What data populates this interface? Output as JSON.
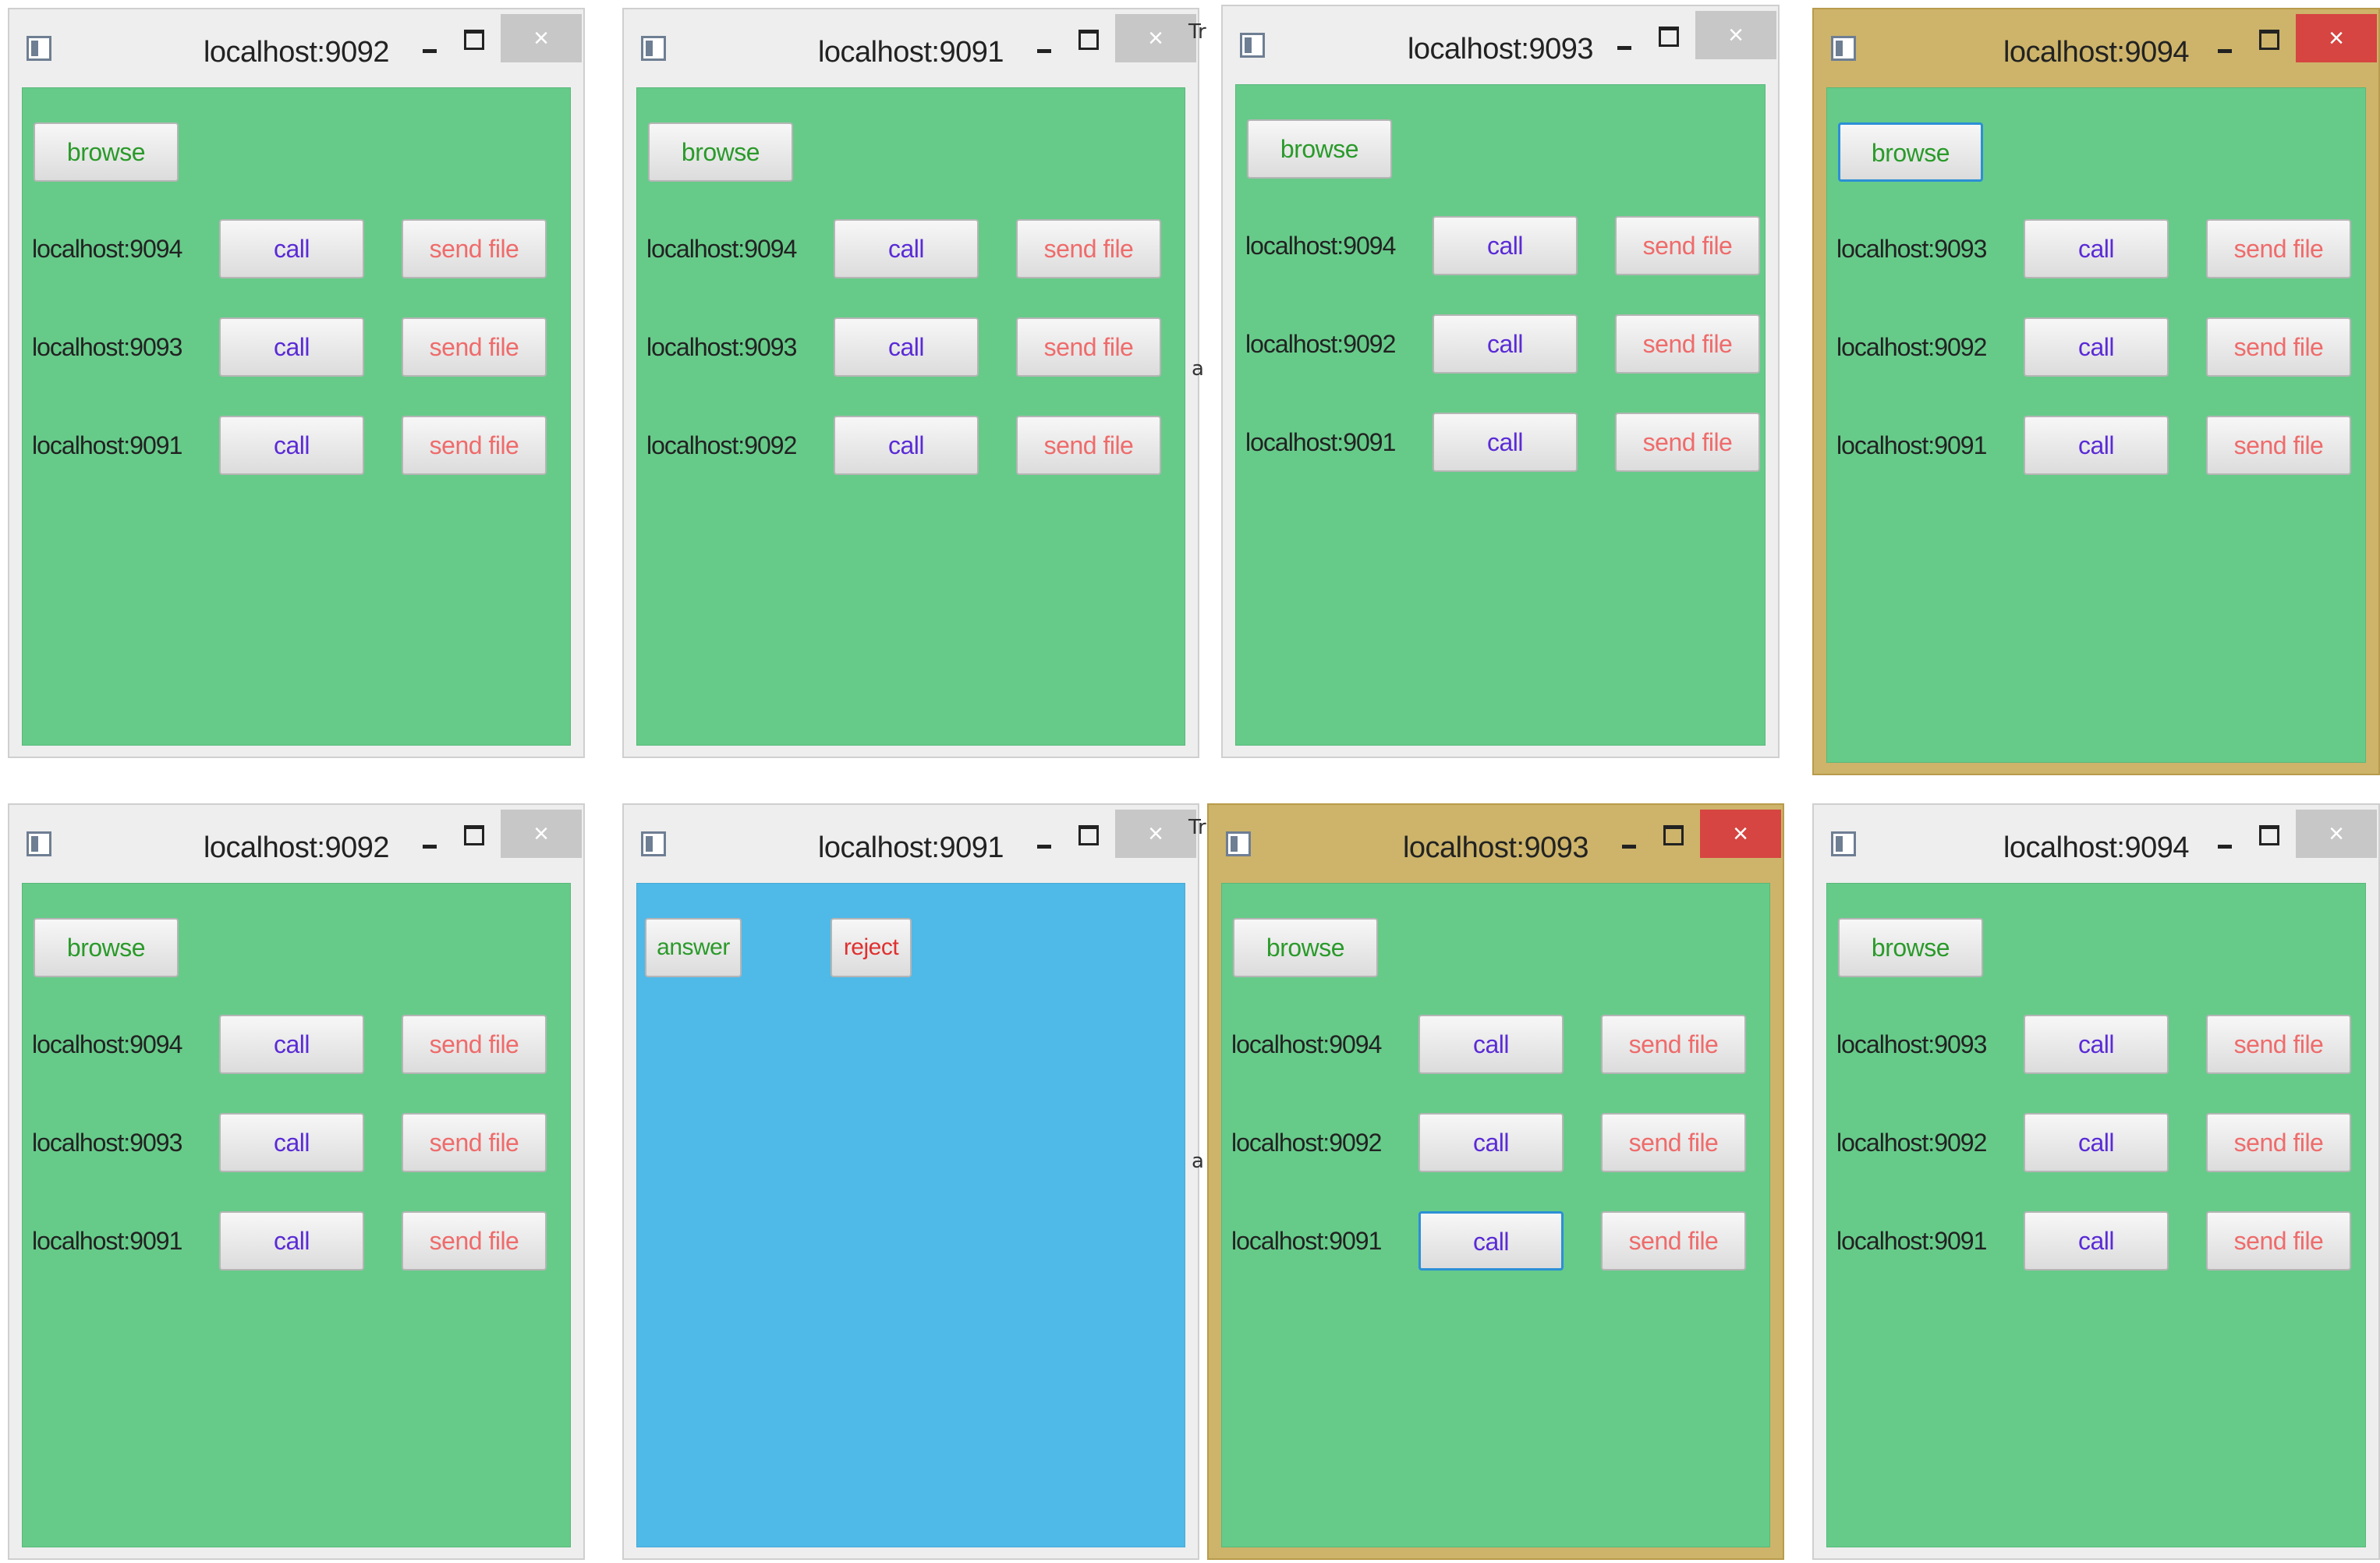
{
  "windows": [
    {
      "title": "localhost:9092",
      "active": false,
      "mode": "peers",
      "browse_label": "browse",
      "peers": [
        {
          "host": "localhost:9094",
          "call": "call",
          "send": "send file"
        },
        {
          "host": "localhost:9093",
          "call": "call",
          "send": "send file"
        },
        {
          "host": "localhost:9091",
          "call": "call",
          "send": "send file"
        }
      ]
    },
    {
      "title": "localhost:9091",
      "active": false,
      "mode": "peers",
      "browse_label": "browse",
      "peers": [
        {
          "host": "localhost:9094",
          "call": "call",
          "send": "send file"
        },
        {
          "host": "localhost:9093",
          "call": "call",
          "send": "send file"
        },
        {
          "host": "localhost:9092",
          "call": "call",
          "send": "send file"
        }
      ]
    },
    {
      "title": "localhost:9093",
      "active": false,
      "mode": "peers",
      "browse_label": "browse",
      "peers": [
        {
          "host": "localhost:9094",
          "call": "call",
          "send": "send file"
        },
        {
          "host": "localhost:9092",
          "call": "call",
          "send": "send file"
        },
        {
          "host": "localhost:9091",
          "call": "call",
          "send": "send file"
        }
      ]
    },
    {
      "title": "localhost:9094",
      "active": true,
      "mode": "peers",
      "browse_label": "browse",
      "browse_focused": true,
      "peers": [
        {
          "host": "localhost:9093",
          "call": "call",
          "send": "send file"
        },
        {
          "host": "localhost:9092",
          "call": "call",
          "send": "send file"
        },
        {
          "host": "localhost:9091",
          "call": "call",
          "send": "send file"
        }
      ]
    },
    {
      "title": "localhost:9092",
      "active": false,
      "mode": "peers",
      "browse_label": "browse",
      "peers": [
        {
          "host": "localhost:9094",
          "call": "call",
          "send": "send file"
        },
        {
          "host": "localhost:9093",
          "call": "call",
          "send": "send file"
        },
        {
          "host": "localhost:9091",
          "call": "call",
          "send": "send file"
        }
      ]
    },
    {
      "title": "localhost:9091",
      "active": false,
      "mode": "incoming",
      "answer_label": "answer",
      "reject_label": "reject"
    },
    {
      "title": "localhost:9093",
      "active": true,
      "mode": "peers",
      "browse_label": "browse",
      "focused_call_row": 2,
      "peers": [
        {
          "host": "localhost:9094",
          "call": "call",
          "send": "send file"
        },
        {
          "host": "localhost:9092",
          "call": "call",
          "send": "send file"
        },
        {
          "host": "localhost:9091",
          "call": "call",
          "send": "send file"
        }
      ]
    },
    {
      "title": "localhost:9094",
      "active": false,
      "mode": "peers",
      "browse_label": "browse",
      "peers": [
        {
          "host": "localhost:9093",
          "call": "call",
          "send": "send file"
        },
        {
          "host": "localhost:9092",
          "call": "call",
          "send": "send file"
        },
        {
          "host": "localhost:9091",
          "call": "call",
          "send": "send file"
        }
      ]
    }
  ],
  "controls": {
    "minimize": "minimize",
    "maximize": "maximize",
    "close": "×"
  },
  "background_fragments": [
    "Tr",
    "a",
    "Tr",
    "a"
  ],
  "colors": {
    "panel_green": "#66cb89",
    "incoming_blue": "#4fb9e8",
    "active_frame": "#cdb46a",
    "active_close": "#d64541",
    "call_text": "#5a2bd6",
    "send_text": "#ef6b6b",
    "browse_text": "#2a9a2a",
    "reject_text": "#e0302f"
  }
}
